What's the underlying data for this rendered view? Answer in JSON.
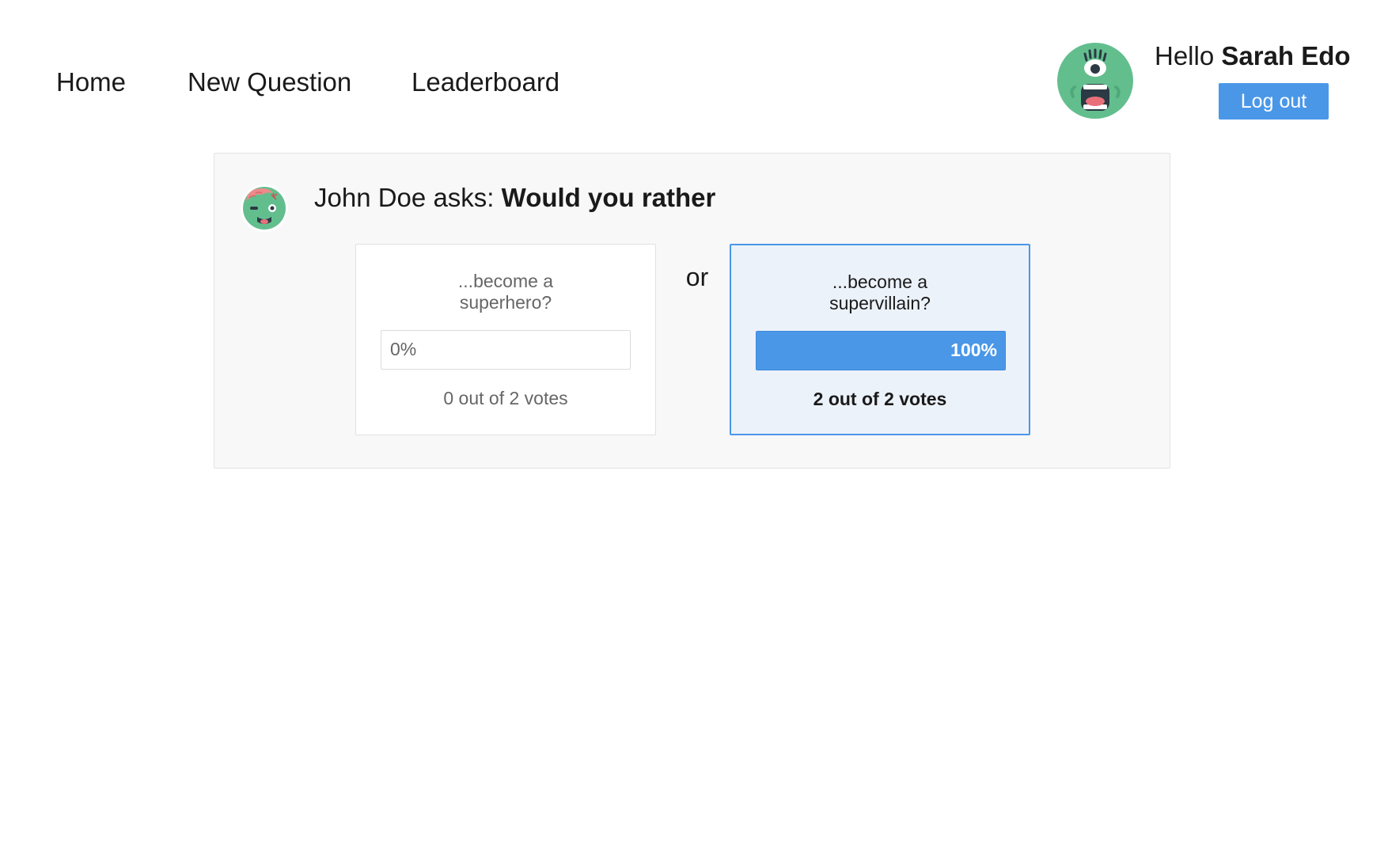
{
  "nav": {
    "items": [
      {
        "label": "Home"
      },
      {
        "label": "New Question"
      },
      {
        "label": "Leaderboard"
      }
    ]
  },
  "user": {
    "greeting": "Hello",
    "name": "Sarah Edo",
    "avatar_icon": "cyclops-monster-avatar",
    "logout_label": "Log out"
  },
  "question": {
    "author": "John Doe",
    "asks_label": "asks:",
    "prompt": "Would you rather",
    "author_avatar_icon": "zombie-avatar",
    "or_label": "or",
    "options": [
      {
        "text": "...become a superhero?",
        "percent_label": "0%",
        "percent": 0,
        "votes_label": "0 out of 2 votes",
        "selected": false
      },
      {
        "text": "...become a supervillain?",
        "percent_label": "100%",
        "percent": 100,
        "votes_label": "2 out of 2 votes",
        "selected": true
      }
    ]
  },
  "colors": {
    "accent": "#4a97e8",
    "selected_bg": "#ecf2fa",
    "card_bg": "#f8f8f8",
    "avatar_green": "#63be8e"
  }
}
